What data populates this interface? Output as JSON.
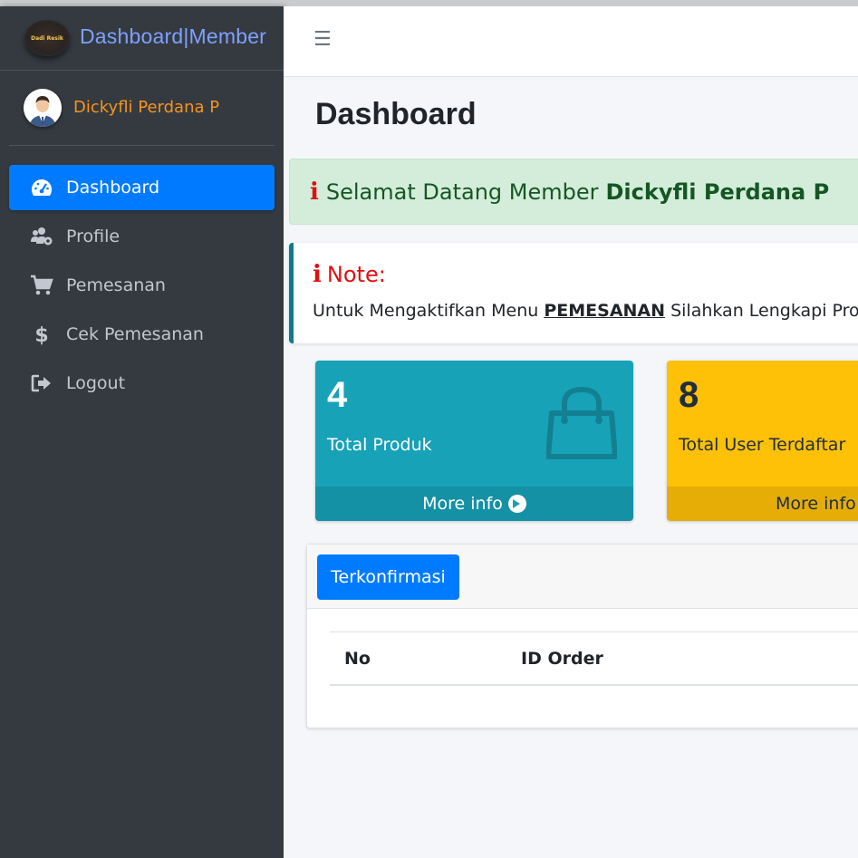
{
  "brand": {
    "title": "Dashboard|Member",
    "logo_text": "Dadi Resik"
  },
  "user": {
    "name": "Dickyfli Perdana P"
  },
  "sidebar": {
    "items": [
      {
        "label": "Dashboard",
        "icon": "tachometer-icon",
        "active": true
      },
      {
        "label": "Profile",
        "icon": "users-cog-icon",
        "active": false
      },
      {
        "label": "Pemesanan",
        "icon": "shopping-cart-icon",
        "active": false
      },
      {
        "label": "Cek Pemesanan",
        "icon": "dollar-icon",
        "active": false
      },
      {
        "label": "Logout",
        "icon": "sign-out-icon",
        "active": false
      }
    ]
  },
  "header": {
    "menu_icon": "bars-icon"
  },
  "page": {
    "title": "Dashboard"
  },
  "welcome": {
    "prefix": "Selamat Datang Member",
    "name": "Dickyfli Perdana P"
  },
  "note": {
    "title": "Note:",
    "text_before": "Untuk Mengaktifkan Menu",
    "text_emph": "PEMESANAN",
    "text_after": "Silahkan Lengkapi Profil Te"
  },
  "stats": [
    {
      "value": "4",
      "label": "Total Produk",
      "footer": "More info",
      "icon": "shopping-bag-icon",
      "color": "#17a2b8"
    },
    {
      "value": "8",
      "label": "Total User Terdaftar",
      "footer": "More info",
      "color": "#ffc107"
    }
  ],
  "orders": {
    "button": "Terkonfirmasi",
    "columns": [
      "No",
      "ID Order"
    ]
  },
  "colors": {
    "sidebar": "#343a40",
    "primary": "#007bff",
    "user_name": "#f7931e",
    "success_bg": "#d4edda",
    "danger": "#e01010"
  }
}
